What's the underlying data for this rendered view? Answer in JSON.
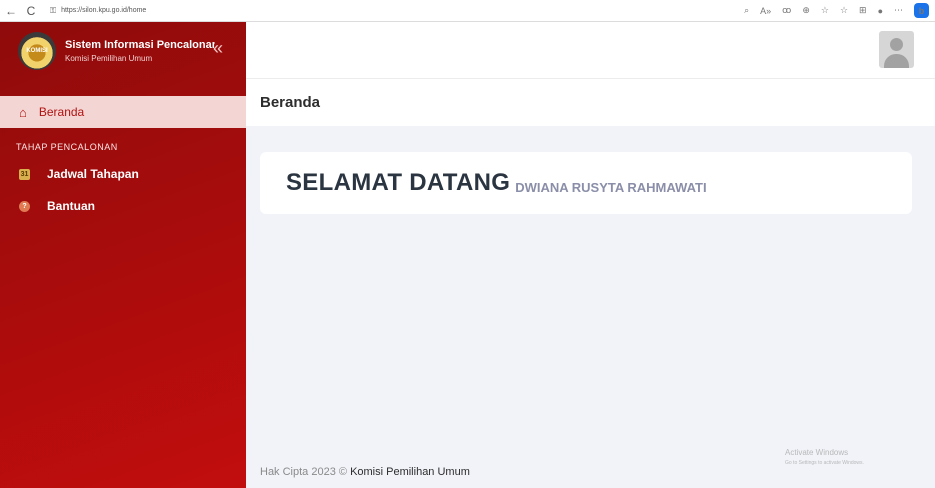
{
  "browser": {
    "back_icon": "←",
    "reload_icon": "C",
    "lock_icon": "⚿",
    "url": "https://silon.kpu.go.id/home",
    "toolbar_icons": [
      "⌕",
      "A»",
      "ꝏ",
      "⊕",
      "☆",
      "☆",
      "⊞",
      "●",
      "⋯"
    ],
    "bing_label": "b"
  },
  "sidebar": {
    "logo_text": "KOMISI",
    "title": "Sistem Informasi Pencalonan",
    "subtitle": "Komisi Pemilihan Umum",
    "collapse_icon": "«",
    "active_item": {
      "icon": "home-icon",
      "glyph": "⌂",
      "label": "Beranda"
    },
    "section_label": "TAHAP PENCALONAN",
    "items": [
      {
        "icon": "calendar-icon",
        "glyph": "31",
        "label": "Jadwal Tahapan"
      },
      {
        "icon": "help-icon",
        "glyph": "?",
        "label": "Bantuan"
      }
    ]
  },
  "header": {
    "avatar": "user-avatar"
  },
  "page": {
    "title": "Beranda",
    "welcome_text": "SELAMAT DATANG",
    "user_name": "DWIANA RUSYTA RAHMAWATI"
  },
  "footer": {
    "copyright": "Hak Cipta 2023 ©",
    "organization": "Komisi Pemilihan Umum"
  },
  "watermark": {
    "title": "Activate Windows",
    "subtitle": "Go to Settings to activate Windows."
  },
  "colors": {
    "sidebar_top": "#8f0b0b",
    "sidebar_bottom": "#c20d0d",
    "active_bg": "#f3d5d3",
    "accent": "#b11212"
  }
}
